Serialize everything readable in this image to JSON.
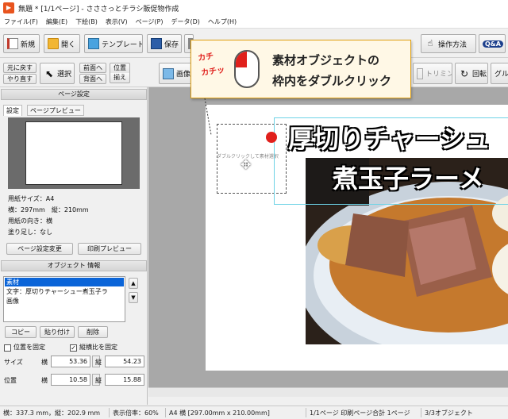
{
  "window": {
    "title": "無題 * [1/1ページ] - さささっとチラシ販促物作成"
  },
  "menu": [
    "ファイル(F)",
    "編集(E)",
    "下絵(B)",
    "表示(V)",
    "ページ(P)",
    "データ(D)",
    "ヘルプ(H)"
  ],
  "toolbar1": {
    "new": "新規",
    "open": "開く",
    "template": "テンプレート",
    "save": "保存",
    "help": "操作方法"
  },
  "toolbar2": {
    "undo": "元に戻す",
    "redo": "やり直す",
    "select": "選択",
    "front": "前面へ",
    "back": "背面へ",
    "align_top": "位置",
    "align_bottom": "揃え",
    "image": "画像",
    "trimming": "トリミング",
    "rotate": "回転",
    "group": "グル"
  },
  "left_panel": {
    "page_settings_header": "ページ設定",
    "tab_settings": "設定",
    "tab_preview": "ページプレビュー",
    "paper_size": "用紙サイズ：A4",
    "dimensions": "横：297mm　縦：210mm",
    "orientation": "用紙の向き：横",
    "bleed": "塗り足し：なし",
    "change_page_settings": "ページ設定変更",
    "print_preview": "印刷プレビュー",
    "object_info_header": "オブジェクト 情報",
    "objects": [
      "素材",
      "文字：厚切りチャーシュー煮玉子ラ",
      "画像"
    ],
    "copy": "コピー",
    "paste": "貼り付け",
    "delete": "削除",
    "fix_position": "位置を固定",
    "fix_ratio": "縦横比を固定",
    "size_label": "サイズ",
    "position_label": "位置",
    "horizontal": "横",
    "vertical": "縦",
    "size_w": "53.36",
    "size_h": "54.23",
    "pos_x": "10.58",
    "pos_y": "15.88"
  },
  "canvas": {
    "headline1": "厚切りチャーシュ",
    "headline2": "煮玉子ラーメ",
    "placeholder": "ダブルクリックして素材選択"
  },
  "callout": {
    "sfx1": "カチ",
    "sfx2": "カチッ",
    "line1": "素材オブジェクトの",
    "line2": "枠内をダブルクリック"
  },
  "status": {
    "cursor": "横：337.3 mm，縦：202.9 mm",
    "zoom": "表示倍率：60%",
    "paper": "A4 横 [297.00mm x 210.00mm]",
    "pages": "1/1ページ 印刷ページ合計 1ページ",
    "objects": "3/3オブジェクト"
  }
}
